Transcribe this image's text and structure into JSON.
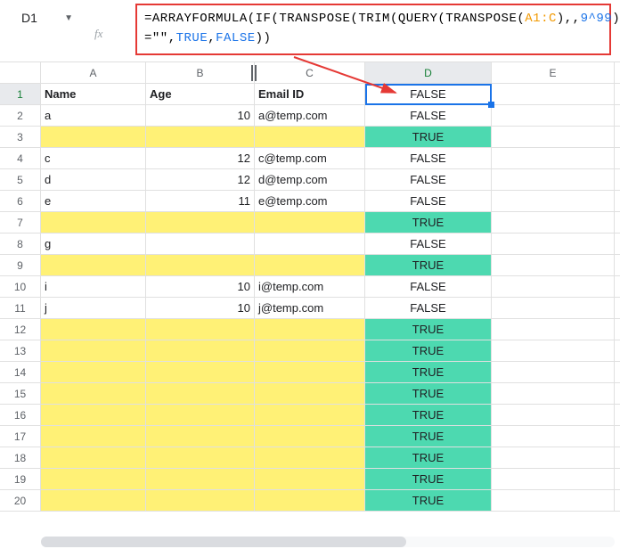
{
  "nameBox": "D1",
  "formula": {
    "prefix": "=ARRAYFORMULA(IF(TRANSPOSE(TRIM(QUERY(TRANSPOSE(",
    "range1": "A1:C",
    "mid1": "),,",
    "num": "9^99",
    "mid2": ")))",
    "line2a": "=\"\",",
    "true": "TRUE",
    "comma": ",",
    "false": "FALSE",
    "tail": "))"
  },
  "colHeaders": {
    "A": "A",
    "B": "B",
    "C": "C",
    "D": "D",
    "E": "E"
  },
  "headers": {
    "A": "Name",
    "B": "Age",
    "C": "Email ID"
  },
  "rows": [
    {
      "n": 1,
      "A": "Name",
      "B": "Age",
      "C": "Email ID",
      "D": "FALSE",
      "hl": "",
      "dhl": "",
      "header": true
    },
    {
      "n": 2,
      "A": "a",
      "B": "10",
      "C": "a@temp.com",
      "D": "FALSE",
      "hl": "",
      "dhl": ""
    },
    {
      "n": 3,
      "A": "",
      "B": "",
      "C": "",
      "D": "TRUE",
      "hl": "yellow",
      "dhl": "teal"
    },
    {
      "n": 4,
      "A": "c",
      "B": "12",
      "C": "c@temp.com",
      "D": "FALSE",
      "hl": "",
      "dhl": ""
    },
    {
      "n": 5,
      "A": "d",
      "B": "12",
      "C": "d@temp.com",
      "D": "FALSE",
      "hl": "",
      "dhl": ""
    },
    {
      "n": 6,
      "A": "e",
      "B": "11",
      "C": "e@temp.com",
      "D": "FALSE",
      "hl": "",
      "dhl": ""
    },
    {
      "n": 7,
      "A": "",
      "B": "",
      "C": "",
      "D": "TRUE",
      "hl": "yellow",
      "dhl": "teal"
    },
    {
      "n": 8,
      "A": "g",
      "B": "",
      "C": "",
      "D": "FALSE",
      "hl": "",
      "dhl": ""
    },
    {
      "n": 9,
      "A": "",
      "B": "",
      "C": "",
      "D": "TRUE",
      "hl": "yellow",
      "dhl": "teal"
    },
    {
      "n": 10,
      "A": "i",
      "B": "10",
      "C": "i@temp.com",
      "D": "FALSE",
      "hl": "",
      "dhl": ""
    },
    {
      "n": 11,
      "A": "j",
      "B": "10",
      "C": "j@temp.com",
      "D": "FALSE",
      "hl": "",
      "dhl": ""
    },
    {
      "n": 12,
      "A": "",
      "B": "",
      "C": "",
      "D": "TRUE",
      "hl": "yellow",
      "dhl": "teal"
    },
    {
      "n": 13,
      "A": "",
      "B": "",
      "C": "",
      "D": "TRUE",
      "hl": "yellow",
      "dhl": "teal"
    },
    {
      "n": 14,
      "A": "",
      "B": "",
      "C": "",
      "D": "TRUE",
      "hl": "yellow",
      "dhl": "teal"
    },
    {
      "n": 15,
      "A": "",
      "B": "",
      "C": "",
      "D": "TRUE",
      "hl": "yellow",
      "dhl": "teal"
    },
    {
      "n": 16,
      "A": "",
      "B": "",
      "C": "",
      "D": "TRUE",
      "hl": "yellow",
      "dhl": "teal"
    },
    {
      "n": 17,
      "A": "",
      "B": "",
      "C": "",
      "D": "TRUE",
      "hl": "yellow",
      "dhl": "teal"
    },
    {
      "n": 18,
      "A": "",
      "B": "",
      "C": "",
      "D": "TRUE",
      "hl": "yellow",
      "dhl": "teal"
    },
    {
      "n": 19,
      "A": "",
      "B": "",
      "C": "",
      "D": "TRUE",
      "hl": "yellow",
      "dhl": "teal"
    },
    {
      "n": 20,
      "A": "",
      "B": "",
      "C": "",
      "D": "TRUE",
      "hl": "yellow",
      "dhl": "teal"
    }
  ]
}
